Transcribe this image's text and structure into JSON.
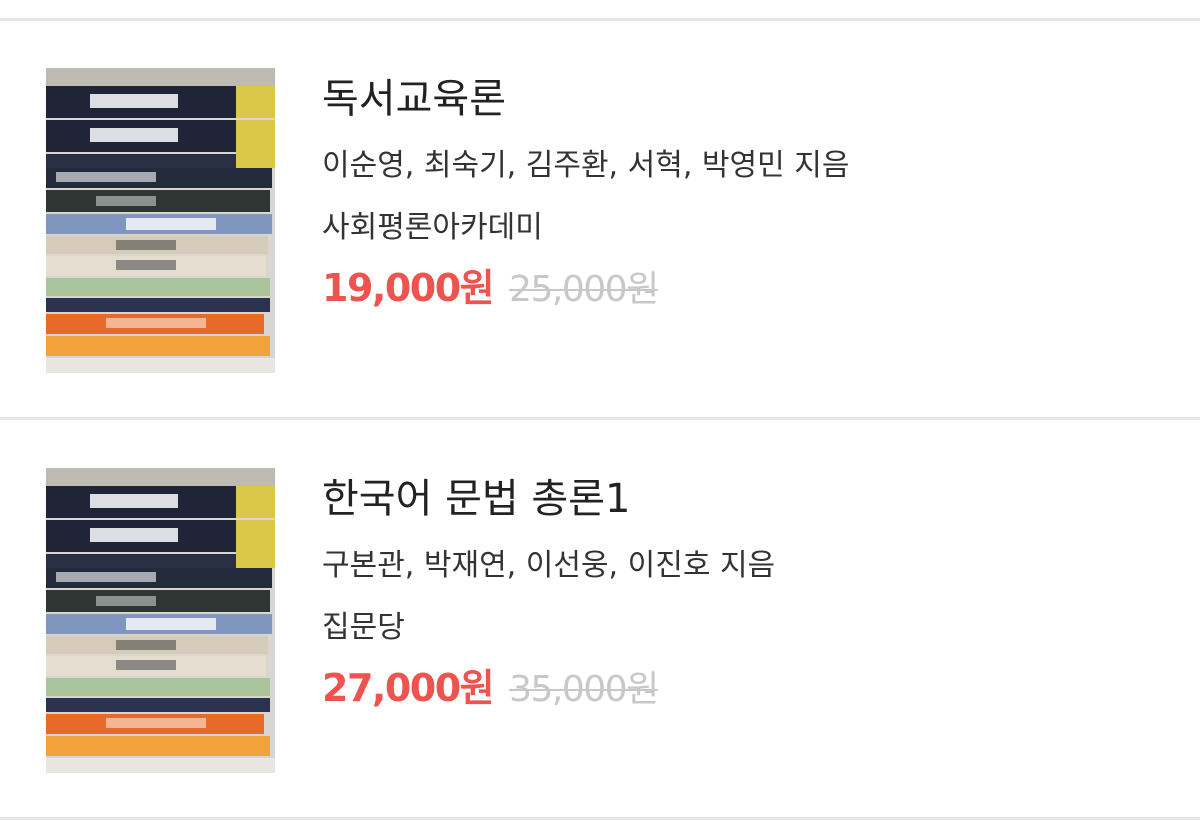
{
  "colors": {
    "sale_price": "#ef5350",
    "original_price": "#c8c8c8",
    "divider": "#e6e6e6"
  },
  "books": [
    {
      "title": "독서교육론",
      "authors": "이순영, 최숙기, 김주환, 서혁, 박영민 지음",
      "publisher": "사회평론아카데미",
      "sale_price": "19,000원",
      "original_price": "25,000원"
    },
    {
      "title": "한국어 문법 총론1",
      "authors": "구본관, 박재연, 이선웅, 이진호 지음",
      "publisher": "집문당",
      "sale_price": "27,000원",
      "original_price": "35,000원"
    }
  ]
}
